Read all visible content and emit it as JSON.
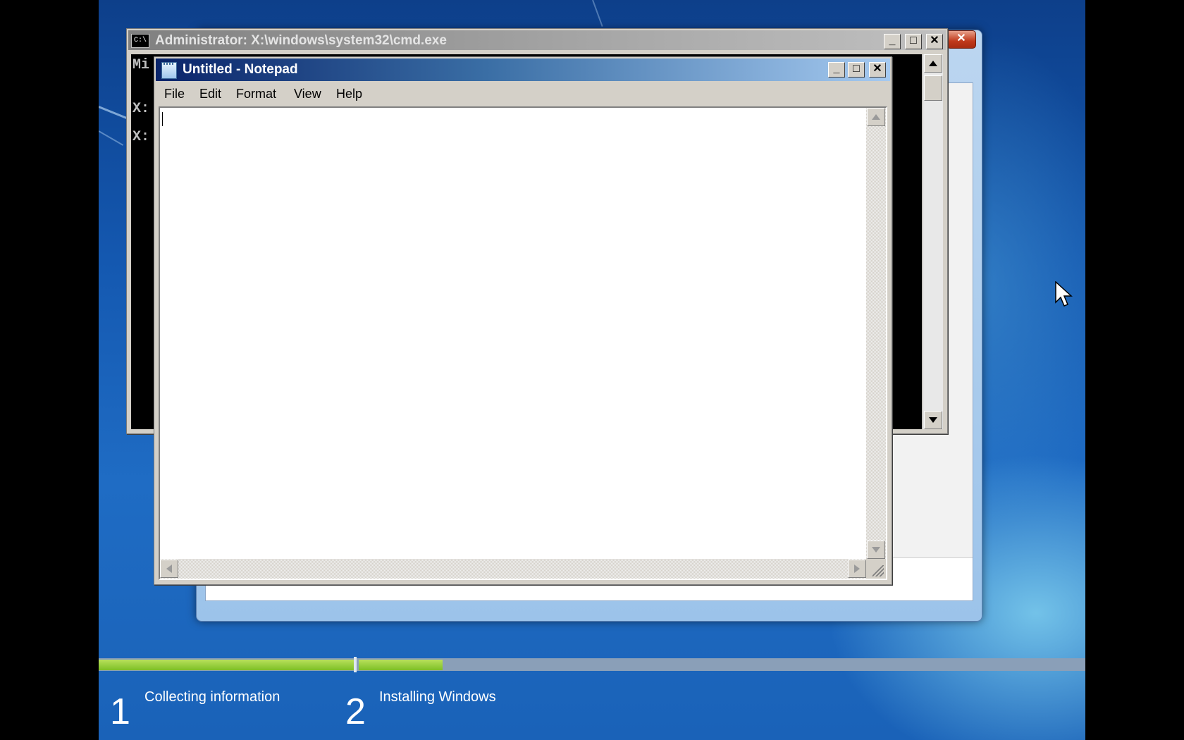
{
  "desktop": {
    "background": "windows-7-blue"
  },
  "cmd_window": {
    "title": "Administrator: X:\\windows\\system32\\cmd.exe",
    "icon_text": "C:\\",
    "lines": [
      "Mi",
      "X:",
      "X:"
    ],
    "buttons": {
      "minimize": "_",
      "maximize": "□",
      "close": "✕"
    }
  },
  "notepad": {
    "title": "Untitled - Notepad",
    "menu": [
      "File",
      "Edit",
      "Format",
      "View",
      "Help"
    ],
    "content": "",
    "buttons": {
      "minimize": "_",
      "maximize": "□",
      "close": "✕"
    }
  },
  "setup": {
    "close_label": "✕",
    "steps": [
      {
        "number": "1",
        "label": "Collecting information"
      },
      {
        "number": "2",
        "label": "Installing Windows"
      }
    ],
    "progress": {
      "step1_complete": 1.0,
      "step2_fraction": 0.13
    }
  },
  "colors": {
    "accent_green": "#7dbf26",
    "notepad_title_start": "#0a246a",
    "notepad_title_end": "#a6caf0",
    "desktop_blue": "#1458b0"
  }
}
